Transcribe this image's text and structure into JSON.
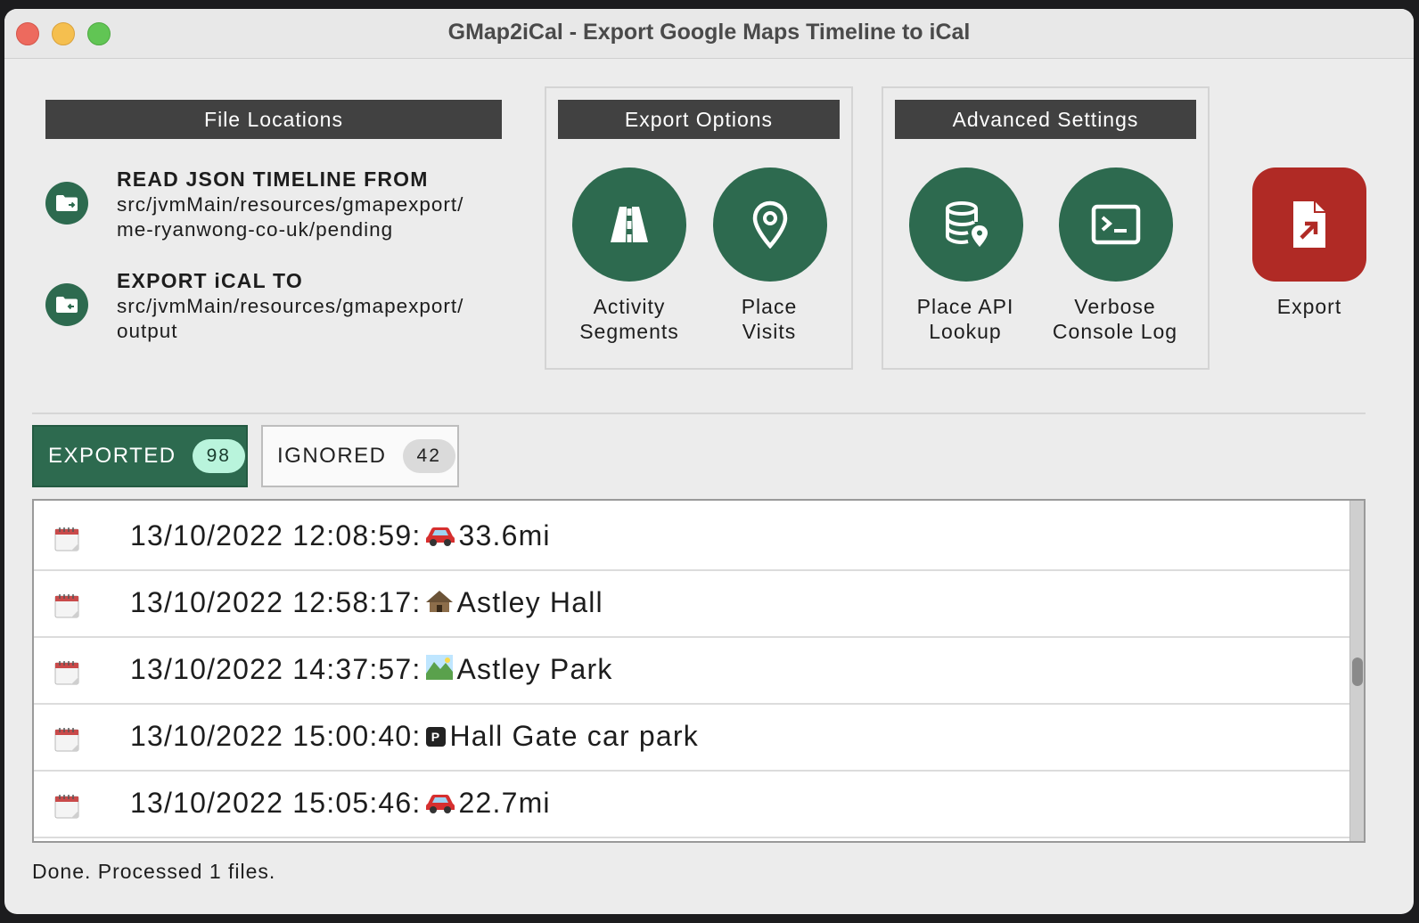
{
  "window": {
    "title": "GMap2iCal - Export Google Maps Timeline to iCal"
  },
  "file_locations": {
    "header": "File Locations",
    "read": {
      "label": "READ JSON TIMELINE FROM",
      "path": "src/jvmMain/resources/gmapexport/\nme-ryanwong-co-uk/pending"
    },
    "export": {
      "label": "EXPORT iCAL TO",
      "path": "src/jvmMain/resources/gmapexport/\noutput"
    }
  },
  "export_options": {
    "header": "Export Options",
    "activity_segments": "Activity\nSegments",
    "place_visits": "Place\nVisits"
  },
  "advanced_settings": {
    "header": "Advanced Settings",
    "place_api_lookup": "Place API\nLookup",
    "verbose_console_log": "Verbose\nConsole Log"
  },
  "export_button": {
    "label": "Export"
  },
  "tabs": {
    "exported": {
      "label": "EXPORTED",
      "count": "98"
    },
    "ignored": {
      "label": "IGNORED",
      "count": "42"
    }
  },
  "entries": [
    {
      "time": "13/10/2022 12:08:59:",
      "emoji": "car",
      "text": "33.6mi"
    },
    {
      "time": "13/10/2022 12:58:17:",
      "emoji": "hut",
      "text": "Astley Hall"
    },
    {
      "time": "13/10/2022 14:37:57:",
      "emoji": "park",
      "text": "Astley Park"
    },
    {
      "time": "13/10/2022 15:00:40:",
      "emoji": "parking",
      "text": "Hall Gate car park"
    },
    {
      "time": "13/10/2022 15:05:46:",
      "emoji": "car",
      "text": "22.7mi"
    }
  ],
  "status": {
    "text": "Done. Processed 1 files."
  },
  "colors": {
    "accent_green": "#2d6a4f",
    "export_red": "#b02a25",
    "header_dark": "#414141",
    "badge_green": "#b9f4dc"
  }
}
